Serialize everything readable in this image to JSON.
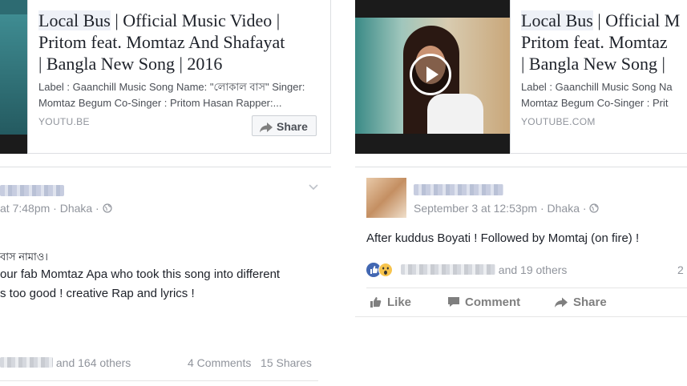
{
  "left_card": {
    "link": {
      "title_highlight": "Local Bus",
      "title_rest_1": " | Official Music Video |",
      "title_line_2": "Pritom feat. Momtaz And Shafayat",
      "title_line_3": "| Bangla New Song | 2016",
      "desc_line_1": "Label : Gaanchill Music Song Name: \"লোকাল বাস\" Singer:",
      "desc_line_2": "Momtaz Begum Co-Singer : Pritom Hasan Rapper:...",
      "domain": "YOUTU.BE",
      "share_label": "Share"
    },
    "post": {
      "timestamp": "at 7:48pm · Dhaka ·",
      "body_line_1": "বাস নামাও।",
      "body_line_2": "our fab Momtaz Apa who took this song into different",
      "body_line_3": "s too good ! creative Rap and lyrics !",
      "likes_suffix": "and 164 others",
      "comments": "4 Comments",
      "shares": "15 Shares"
    }
  },
  "right_card": {
    "link": {
      "title_highlight": "Local Bus",
      "title_rest_1": " | Official M",
      "title_line_2": "Pritom feat. Momtaz",
      "title_line_3": "| Bangla New Song |",
      "desc_line_1": "Label : Gaanchill Music Song Na",
      "desc_line_2": "Momtaz Begum Co-Singer : Prit",
      "domain": "YOUTUBE.COM"
    },
    "post": {
      "timestamp": "September 3 at 12:53pm · Dhaka ·",
      "body_line_1": "After kuddus Boyati ! Followed by Momtaj (on fire) !",
      "likes_suffix": "and 19 others",
      "count_right": "2",
      "actions": {
        "like": "Like",
        "comment": "Comment",
        "share": "Share"
      }
    }
  },
  "colors": {
    "fb_blue": "#4267b2",
    "text": "#1d2129",
    "muted": "#90949c"
  }
}
